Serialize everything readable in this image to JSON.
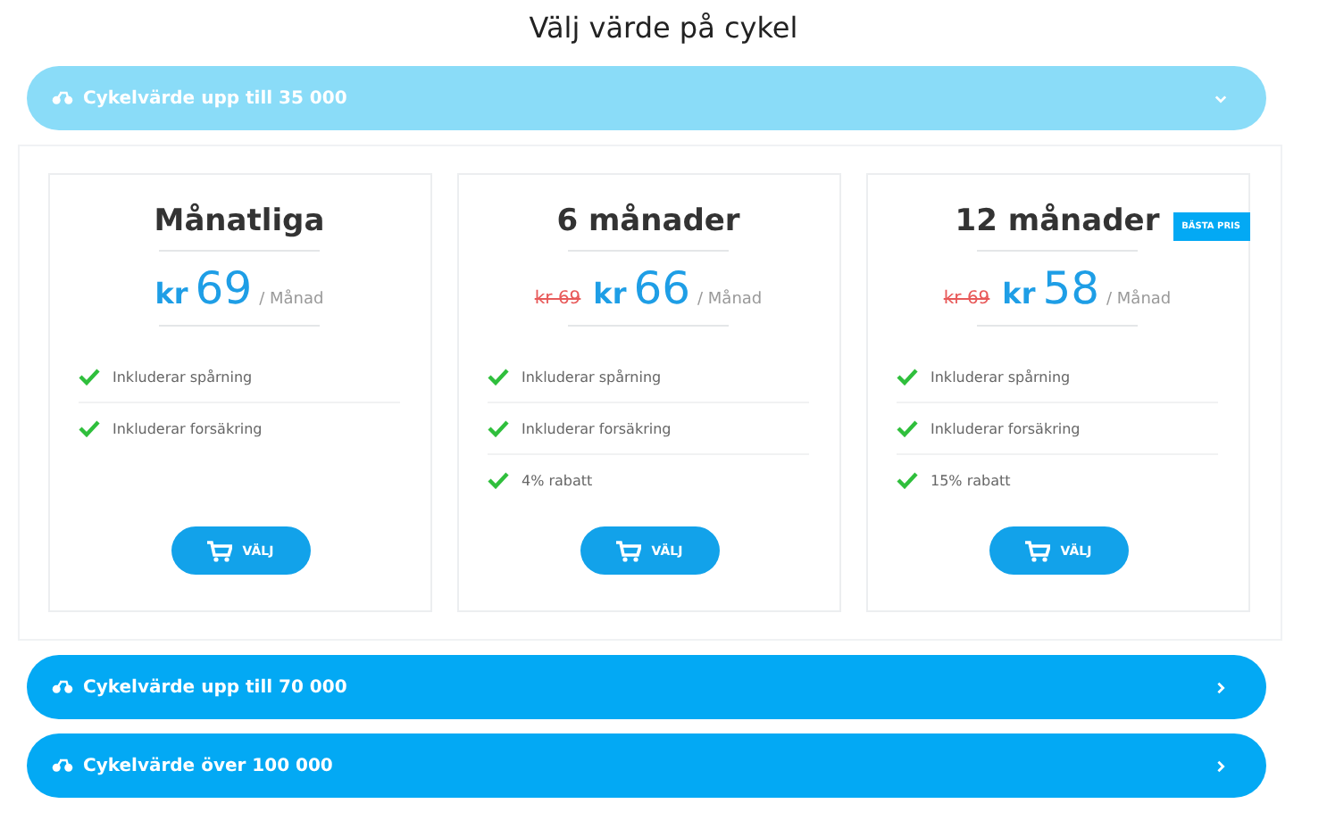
{
  "title": "Välj värde på cykel",
  "sections": [
    {
      "label": "Cykelvärde upp till 35 000",
      "expanded": true,
      "plans": [
        {
          "name": "Månatliga",
          "currency": "kr",
          "price": "69",
          "unit": "/ Månad",
          "features": [
            "Inkluderar spårning",
            "Inkluderar forsäkring"
          ],
          "button": "VÄLJ"
        },
        {
          "name": "6 månader",
          "old_price": "kr 69",
          "currency": "kr",
          "price": "66",
          "unit": "/ Månad",
          "features": [
            "Inkluderar spårning",
            "Inkluderar forsäkring",
            "4% rabatt"
          ],
          "button": "VÄLJ"
        },
        {
          "name": "12 månader",
          "badge": "BÄSTA PRIS",
          "old_price": "kr 69",
          "currency": "kr",
          "price": "58",
          "unit": "/ Månad",
          "features": [
            "Inkluderar spårning",
            "Inkluderar forsäkring",
            "15% rabatt"
          ],
          "button": "VÄLJ"
        }
      ]
    },
    {
      "label": "Cykelvärde upp till 70 000",
      "expanded": false
    },
    {
      "label": "Cykelvärde över 100 000",
      "expanded": false
    }
  ]
}
